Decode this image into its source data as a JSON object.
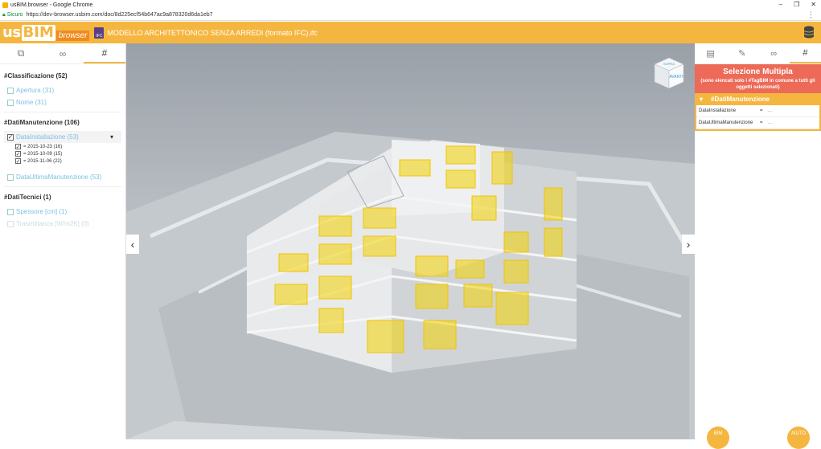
{
  "browser": {
    "window_title": "usBIM.browser - Google Chrome",
    "secure_label": "Sicuro",
    "url": "https://dev-browser.usbim.com/doc/8d225ecf54b647ac9a878320d6da1eb7"
  },
  "header": {
    "logo_us": "us",
    "logo_bim": "BIM",
    "logo_browser": "browser",
    "ifc_badge": "IFC",
    "project_title": "MODELLO ARCHITETTONICO SENZA ARREDI (formato IFC).ifc"
  },
  "left_panel": {
    "tabs": [
      {
        "icon": "hierarchy-icon",
        "glyph": "⧉"
      },
      {
        "icon": "link-icon",
        "glyph": "∞"
      },
      {
        "icon": "hashtag-icon",
        "glyph": "#"
      }
    ],
    "groups": {
      "classificazione": {
        "title": "#Classificazione (52)",
        "items": [
          "Apertura (31)",
          "Nome (31)"
        ]
      },
      "dati_manutenzione": {
        "title": "#DatiManutenzione (106)",
        "installazione_label": "DataInstallazione (53)",
        "installazione_values": [
          "= 2015-10-23 (16)",
          "= 2015-10-09 (15)",
          "= 2015-11-06 (22)"
        ],
        "ultima_label": "DataUltimaManutenzione (53)"
      },
      "dati_tecnici": {
        "title": "#DatiTecnici (1)",
        "items": [
          "Spessore [cm] (1)",
          "Trasmittanza [W/m2K] (0)"
        ]
      }
    },
    "collapse_glyph": "▾"
  },
  "viewer": {
    "nav_left": "‹",
    "nav_right": "›",
    "viewcube_top": "SOPRA",
    "viewcube_front": "AVANTI"
  },
  "right_panel": {
    "tabs": [
      {
        "icon": "document-icon",
        "glyph": "▤"
      },
      {
        "icon": "edit-icon",
        "glyph": "✎"
      },
      {
        "icon": "link-icon",
        "glyph": "∞"
      },
      {
        "icon": "hashtag-icon",
        "glyph": "#"
      }
    ],
    "selection_title": "Selezione Multipla",
    "selection_subtitle": "(sono elencati solo i #TagBIM in comune a tutti gli oggetti selezionati)",
    "section_title": "#DatiManutenzione",
    "section_chevron": "▾",
    "properties": [
      {
        "key": "DataInstallazione",
        "eq": "=",
        "value": "..."
      },
      {
        "key": "DataUltimaManutenzione",
        "eq": "=",
        "value": "..."
      }
    ]
  },
  "fabs": {
    "left_label": "BIM",
    "right_label": "AIUTO"
  },
  "colors": {
    "accent": "#f5b640",
    "selection_header": "#ec6a57",
    "highlight": "#f2d100"
  }
}
